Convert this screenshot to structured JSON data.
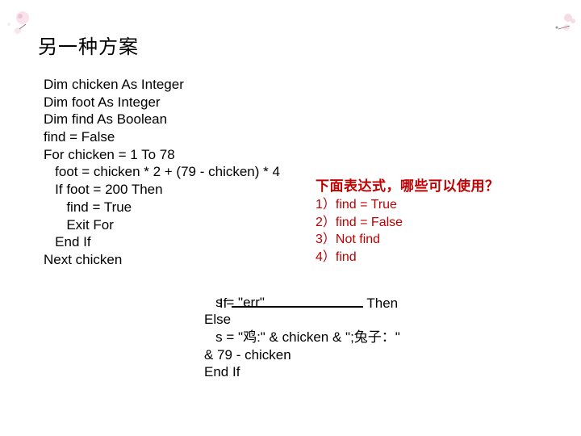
{
  "slide": {
    "title": "另一种方案",
    "code_block_1": {
      "lines": [
        "Dim chicken As Integer",
        "Dim foot As Integer",
        "Dim find As Boolean",
        "find = False",
        "For chicken = 1 To 78",
        "   foot = chicken * 2 + (79 - chicken) * 4",
        "   If foot = 200 Then",
        "      find = True",
        "      Exit For",
        "   End If",
        "Next chicken"
      ]
    },
    "question": {
      "title": "下面表达式，哪些可以使用？",
      "options": [
        "1）find = True",
        "2）find = False",
        "3）Not find",
        "4）find"
      ],
      "color": "#c00000"
    },
    "code_block_2": {
      "if_keyword": "If",
      "then_keyword": "Then",
      "lines": [
        "   s = \"err\"",
        "Else",
        "   s = \"鸡:\" & chicken & \";兔子：\"",
        "& 79 - chicken",
        "End If"
      ]
    }
  }
}
